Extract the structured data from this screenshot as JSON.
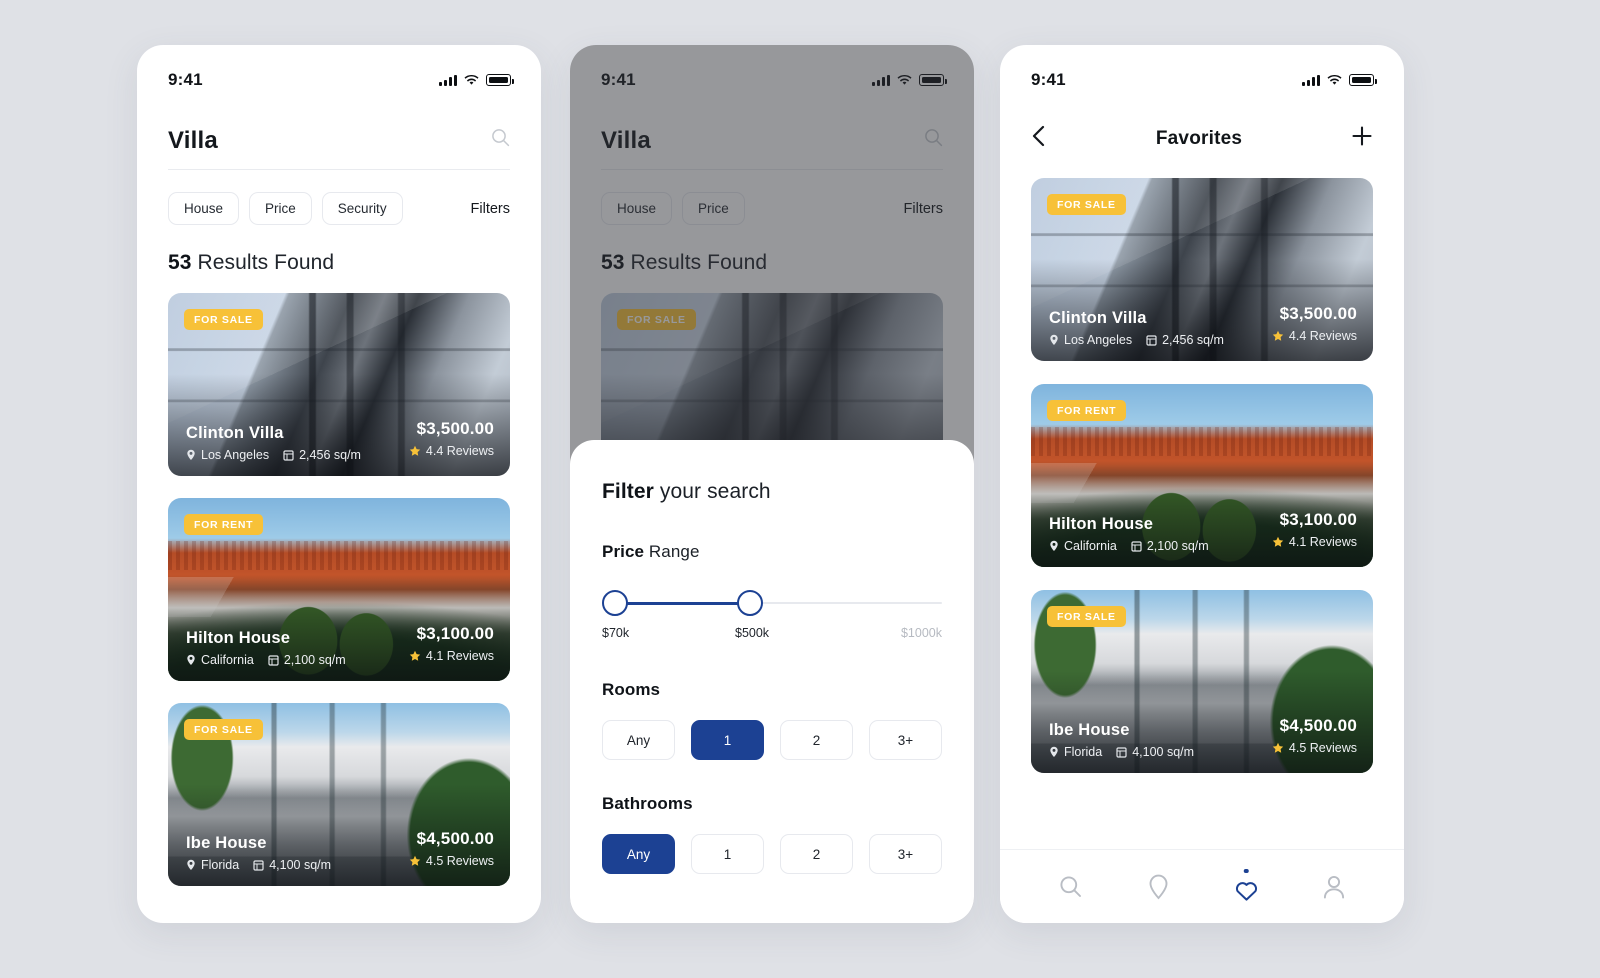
{
  "meta": {
    "background_color": "#dfe1e6",
    "accent_blue": "#1c4193",
    "badge_yellow": "#f7c138"
  },
  "status_bar": {
    "time": "9:41",
    "signal_icon": "signal-bars-icon",
    "wifi_icon": "wifi-icon",
    "battery_icon": "battery-icon"
  },
  "screen_search": {
    "search": {
      "value": "Villa",
      "placeholder": "Search",
      "icon": "search-icon"
    },
    "chips": [
      {
        "label": "House"
      },
      {
        "label": "Price"
      },
      {
        "label": "Security"
      }
    ],
    "filters_label": "Filters",
    "results": {
      "count": "53",
      "text": "Results Found"
    },
    "properties": [
      {
        "badge": "FOR SALE",
        "name": "Clinton Villa",
        "location": "Los Angeles",
        "area": "2,456 sq/m",
        "price": "$3,500.00",
        "reviews": "4.4 Reviews",
        "photo": "ph-clinton"
      },
      {
        "badge": "FOR RENT",
        "name": "Hilton House",
        "location": "California",
        "area": "2,100 sq/m",
        "price": "$3,100.00",
        "reviews": "4.1 Reviews",
        "photo": "ph-hilton"
      },
      {
        "badge": "FOR SALE",
        "name": "Ibe House",
        "location": "Florida",
        "area": "4,100 sq/m",
        "price": "$4,500.00",
        "reviews": "4.5 Reviews",
        "photo": "ph-ibe"
      }
    ]
  },
  "screen_filter": {
    "search": {
      "value": "Villa",
      "icon": "search-icon"
    },
    "chips": [
      {
        "label": "House"
      },
      {
        "label": "Price"
      }
    ],
    "filters_label": "Filters",
    "results": {
      "count": "53",
      "text": "Results Found"
    },
    "background_card": {
      "badge": "FOR SALE",
      "photo": "ph-clinton"
    },
    "sheet": {
      "title_bold": "Filter",
      "title_rest": " your search",
      "price_section": {
        "title_bold": "Price",
        "title_rest": " Range",
        "min_label": "$70k",
        "selected_label": "$500k",
        "max_label": "$1000k",
        "min_value": 70,
        "selected_value": 500,
        "max_value": 1000
      },
      "rooms": {
        "title": "Rooms",
        "options": [
          "Any",
          "1",
          "2",
          "3+"
        ],
        "selected": "1"
      },
      "bathrooms": {
        "title": "Bathrooms",
        "options": [
          "Any",
          "1",
          "2",
          "3+"
        ],
        "selected": "Any"
      }
    }
  },
  "screen_favorites": {
    "header": {
      "back_icon": "chevron-left-icon",
      "title": "Favorites",
      "add_icon": "plus-icon"
    },
    "properties": [
      {
        "badge": "FOR SALE",
        "name": "Clinton Villa",
        "location": "Los Angeles",
        "area": "2,456 sq/m",
        "price": "$3,500.00",
        "reviews": "4.4 Reviews",
        "photo": "ph-clinton"
      },
      {
        "badge": "FOR RENT",
        "name": "Hilton House",
        "location": "California",
        "area": "2,100 sq/m",
        "price": "$3,100.00",
        "reviews": "4.1 Reviews",
        "photo": "ph-hilton"
      },
      {
        "badge": "FOR SALE",
        "name": "Ibe House",
        "location": "Florida",
        "area": "4,100 sq/m",
        "price": "$4,500.00",
        "reviews": "4.5 Reviews",
        "photo": "ph-ibe"
      }
    ],
    "bottom_nav": [
      {
        "icon": "search-icon",
        "active": false
      },
      {
        "icon": "location-pin-icon",
        "active": false
      },
      {
        "icon": "heart-icon",
        "active": true
      },
      {
        "icon": "person-icon",
        "active": false
      }
    ]
  }
}
